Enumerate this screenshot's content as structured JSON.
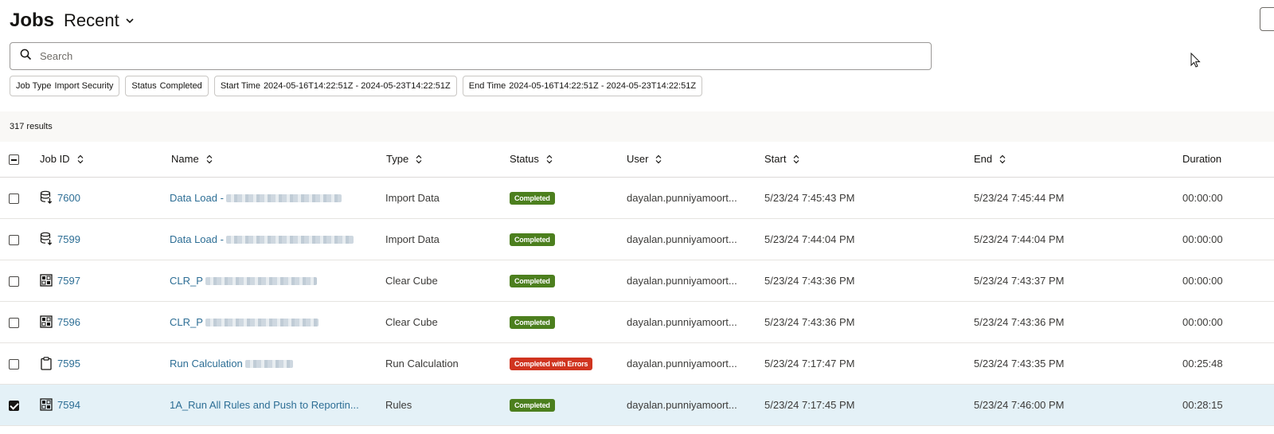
{
  "header": {
    "title": "Jobs",
    "view": "Recent"
  },
  "search": {
    "placeholder": "Search"
  },
  "filters": [
    {
      "key": "Job Type",
      "value": "Import Security"
    },
    {
      "key": "Status",
      "value": "Completed"
    },
    {
      "key": "Start Time",
      "value": "2024-05-16T14:22:51Z - 2024-05-23T14:22:51Z"
    },
    {
      "key": "End Time",
      "value": "2024-05-16T14:22:51Z - 2024-05-23T14:22:51Z"
    }
  ],
  "results": {
    "text": "317 results"
  },
  "columns": {
    "job_id": "Job ID",
    "name": "Name",
    "type": "Type",
    "status": "Status",
    "user": "User",
    "start": "Start",
    "end": "End",
    "duration": "Duration"
  },
  "colors": {
    "completed": "#4c7f1e",
    "completed_errors": "#d0341f",
    "link": "#2d6e95",
    "selected_row": "#e4f1f7"
  },
  "rows": [
    {
      "icon": "database-import-icon",
      "job_id": "7600",
      "name": "Data Load -",
      "type": "Import Data",
      "status": "Completed",
      "status_kind": "completed",
      "user": "dayalan.punniyamoort...",
      "start": "5/23/24 7:45:43 PM",
      "end": "5/23/24 7:45:44 PM",
      "duration": "00:00:00",
      "selected": false
    },
    {
      "icon": "database-import-icon",
      "job_id": "7599",
      "name": "Data Load -",
      "type": "Import Data",
      "status": "Completed",
      "status_kind": "completed",
      "user": "dayalan.punniyamoort...",
      "start": "5/23/24 7:44:04 PM",
      "end": "5/23/24 7:44:04 PM",
      "duration": "00:00:00",
      "selected": false
    },
    {
      "icon": "cube-grid-icon",
      "job_id": "7597",
      "name": "CLR_P",
      "type": "Clear Cube",
      "status": "Completed",
      "status_kind": "completed",
      "user": "dayalan.punniyamoort...",
      "start": "5/23/24 7:43:36 PM",
      "end": "5/23/24 7:43:37 PM",
      "duration": "00:00:00",
      "selected": false
    },
    {
      "icon": "cube-grid-icon",
      "job_id": "7596",
      "name": "CLR_P",
      "type": "Clear Cube",
      "status": "Completed",
      "status_kind": "completed",
      "user": "dayalan.punniyamoort...",
      "start": "5/23/24 7:43:36 PM",
      "end": "5/23/24 7:43:36 PM",
      "duration": "00:00:00",
      "selected": false
    },
    {
      "icon": "clipboard-icon",
      "job_id": "7595",
      "name": "Run Calculation",
      "type": "Run Calculation",
      "status": "Completed with Errors",
      "status_kind": "completed_errors",
      "user": "dayalan.punniyamoort...",
      "start": "5/23/24 7:17:47 PM",
      "end": "5/23/24 7:43:35 PM",
      "duration": "00:25:48",
      "selected": false
    },
    {
      "icon": "cube-grid-icon",
      "job_id": "7594",
      "name": "1A_Run All Rules and Push to Reportin...",
      "type": "Rules",
      "status": "Completed",
      "status_kind": "completed",
      "user": "dayalan.punniyamoort...",
      "start": "5/23/24 7:17:45 PM",
      "end": "5/23/24 7:46:00 PM",
      "duration": "00:28:15",
      "selected": true
    }
  ]
}
